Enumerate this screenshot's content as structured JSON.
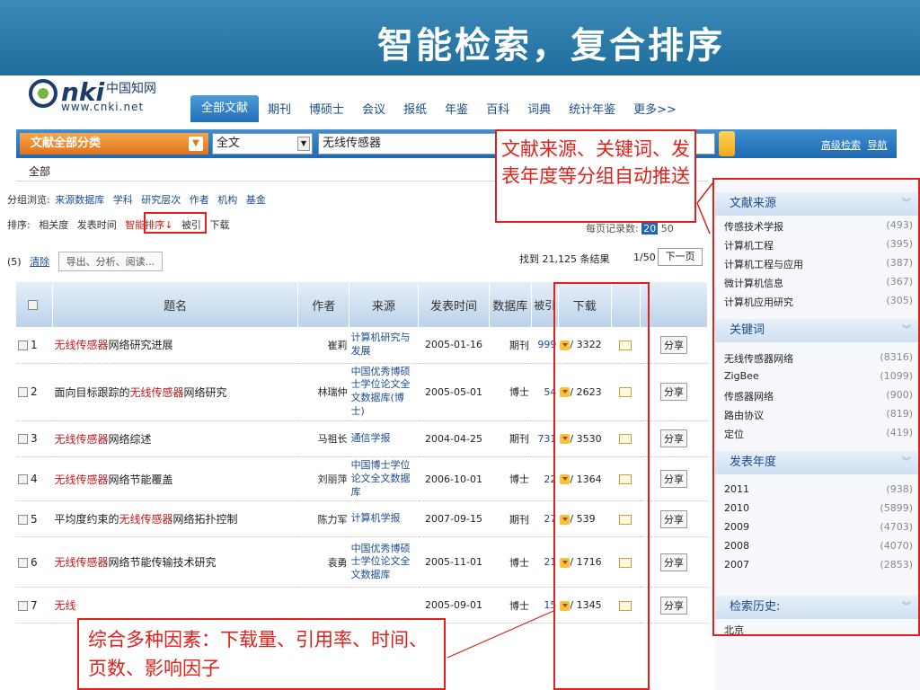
{
  "slide": {
    "title": "智能检索，复合排序"
  },
  "logo": {
    "brand": "nki",
    "cn": "中国知网",
    "url": "www.cnki.net"
  },
  "tabs": [
    "全部文献",
    "期刊",
    "博硕士",
    "会议",
    "报纸",
    "年鉴",
    "百科",
    "词典",
    "统计年鉴",
    "更多>>"
  ],
  "search": {
    "category": "文献全部分类",
    "field": "全文",
    "query": "无线传感器",
    "adv_search": "高级检索",
    "nav": "导航"
  },
  "scope": "全部",
  "grouping": {
    "label": "分组浏览:",
    "items": [
      "来源数据库",
      "学科",
      "研究层次",
      "作者",
      "机构",
      "基金"
    ]
  },
  "sorting": {
    "label": "排序:",
    "items": [
      "相关度",
      "发表时间",
      "智能排序↓",
      "被引",
      "下载"
    ]
  },
  "actions": {
    "count": "(5)",
    "clear": "清除",
    "export": "导出、分析、阅读..."
  },
  "results_info": {
    "found": "找到 21,125 条结果",
    "page": "1/50",
    "next": "下一页",
    "per_page_label": "每页记录数:",
    "per_page": "20",
    "per_page_alt": "50"
  },
  "table": {
    "headers": [
      "题名",
      "作者",
      "来源",
      "发表时间",
      "数据库",
      "被引",
      "下载"
    ],
    "rows": [
      {
        "no": "1",
        "title_hl": "无线传感器",
        "title_pre": "",
        "title_post": "网络研究进展",
        "author": "崔莉",
        "source": "计算机研究与发展",
        "date": "2005-01-16",
        "db": "期刊",
        "cited": "999",
        "downloads": "/ 3322",
        "share": "分享"
      },
      {
        "no": "2",
        "title_hl": "无线传感器",
        "title_pre": "面向目标跟踪的",
        "title_post": "网络研究",
        "author": "林瑞仲",
        "source": "中国优秀博硕士学位论文全文数据库(博士)",
        "date": "2005-05-01",
        "db": "博士",
        "cited": "54",
        "downloads": "/ 2623",
        "share": "分享"
      },
      {
        "no": "3",
        "title_hl": "无线传感器",
        "title_pre": "",
        "title_post": "网络综述",
        "author": "马祖长",
        "source": "通信学报",
        "date": "2004-04-25",
        "db": "期刊",
        "cited": "731",
        "downloads": "/ 3530",
        "share": "分享"
      },
      {
        "no": "4",
        "title_hl": "无线传感器",
        "title_pre": "",
        "title_post": "网络节能覆盖",
        "author": "刘丽萍",
        "source": "中国博士学位论文全文数据库",
        "date": "2006-10-01",
        "db": "博士",
        "cited": "22",
        "downloads": "/ 1364",
        "share": "分享"
      },
      {
        "no": "5",
        "title_hl": "无线传感器",
        "title_pre": "平均度约束的",
        "title_post": "网络拓扑控制",
        "author": "陈力军",
        "source": "计算机学报",
        "date": "2007-09-15",
        "db": "期刊",
        "cited": "27",
        "downloads": "/ 539",
        "share": "分享"
      },
      {
        "no": "6",
        "title_hl": "无线传感器",
        "title_pre": "",
        "title_post": "网络节能传输技术研究",
        "author": "袁勇",
        "source": "中国优秀博硕士学位论文全文数据库",
        "date": "2005-11-01",
        "db": "博士",
        "cited": "21",
        "downloads": "/ 1716",
        "share": "分享"
      },
      {
        "no": "7",
        "title_hl": "无线",
        "title_pre": "",
        "title_post": "",
        "author": "",
        "source": "",
        "date": "2005-09-01",
        "db": "博士",
        "cited": "15",
        "downloads": "/ 1345",
        "share": "分享"
      }
    ]
  },
  "facets": [
    {
      "title": "文献来源",
      "items": [
        {
          "label": "传感技术学报",
          "count": "(493)"
        },
        {
          "label": "计算机工程",
          "count": "(395)"
        },
        {
          "label": "计算机工程与应用",
          "count": "(387)"
        },
        {
          "label": "微计算机信息",
          "count": "(367)"
        },
        {
          "label": "计算机应用研究",
          "count": "(305)"
        }
      ]
    },
    {
      "title": "关键词",
      "items": [
        {
          "label": "无线传感器网络",
          "count": "(8316)"
        },
        {
          "label": "ZigBee",
          "count": "(1099)"
        },
        {
          "label": "传感器网络",
          "count": "(900)"
        },
        {
          "label": "路由协议",
          "count": "(819)"
        },
        {
          "label": "定位",
          "count": "(419)"
        }
      ]
    },
    {
      "title": "发表年度",
      "items": [
        {
          "label": "2011",
          "count": "(938)"
        },
        {
          "label": "2010",
          "count": "(5899)"
        },
        {
          "label": "2009",
          "count": "(4703)"
        },
        {
          "label": "2008",
          "count": "(4070)"
        },
        {
          "label": "2007",
          "count": "(2853)"
        }
      ]
    },
    {
      "title": "检索历史:",
      "items": [
        {
          "label": "北京",
          "count": ""
        }
      ]
    }
  ],
  "annotations": {
    "facets_note": "文献来源、关键词、发表年度等分组自动推送",
    "ranking_note": "综合多种因素：下载量、引用率、时间、页数、影响因子"
  },
  "colors": {
    "header_blue": "#1e6d9c",
    "highlight_red": "#e0201a",
    "link_blue": "#1a4c8f"
  }
}
